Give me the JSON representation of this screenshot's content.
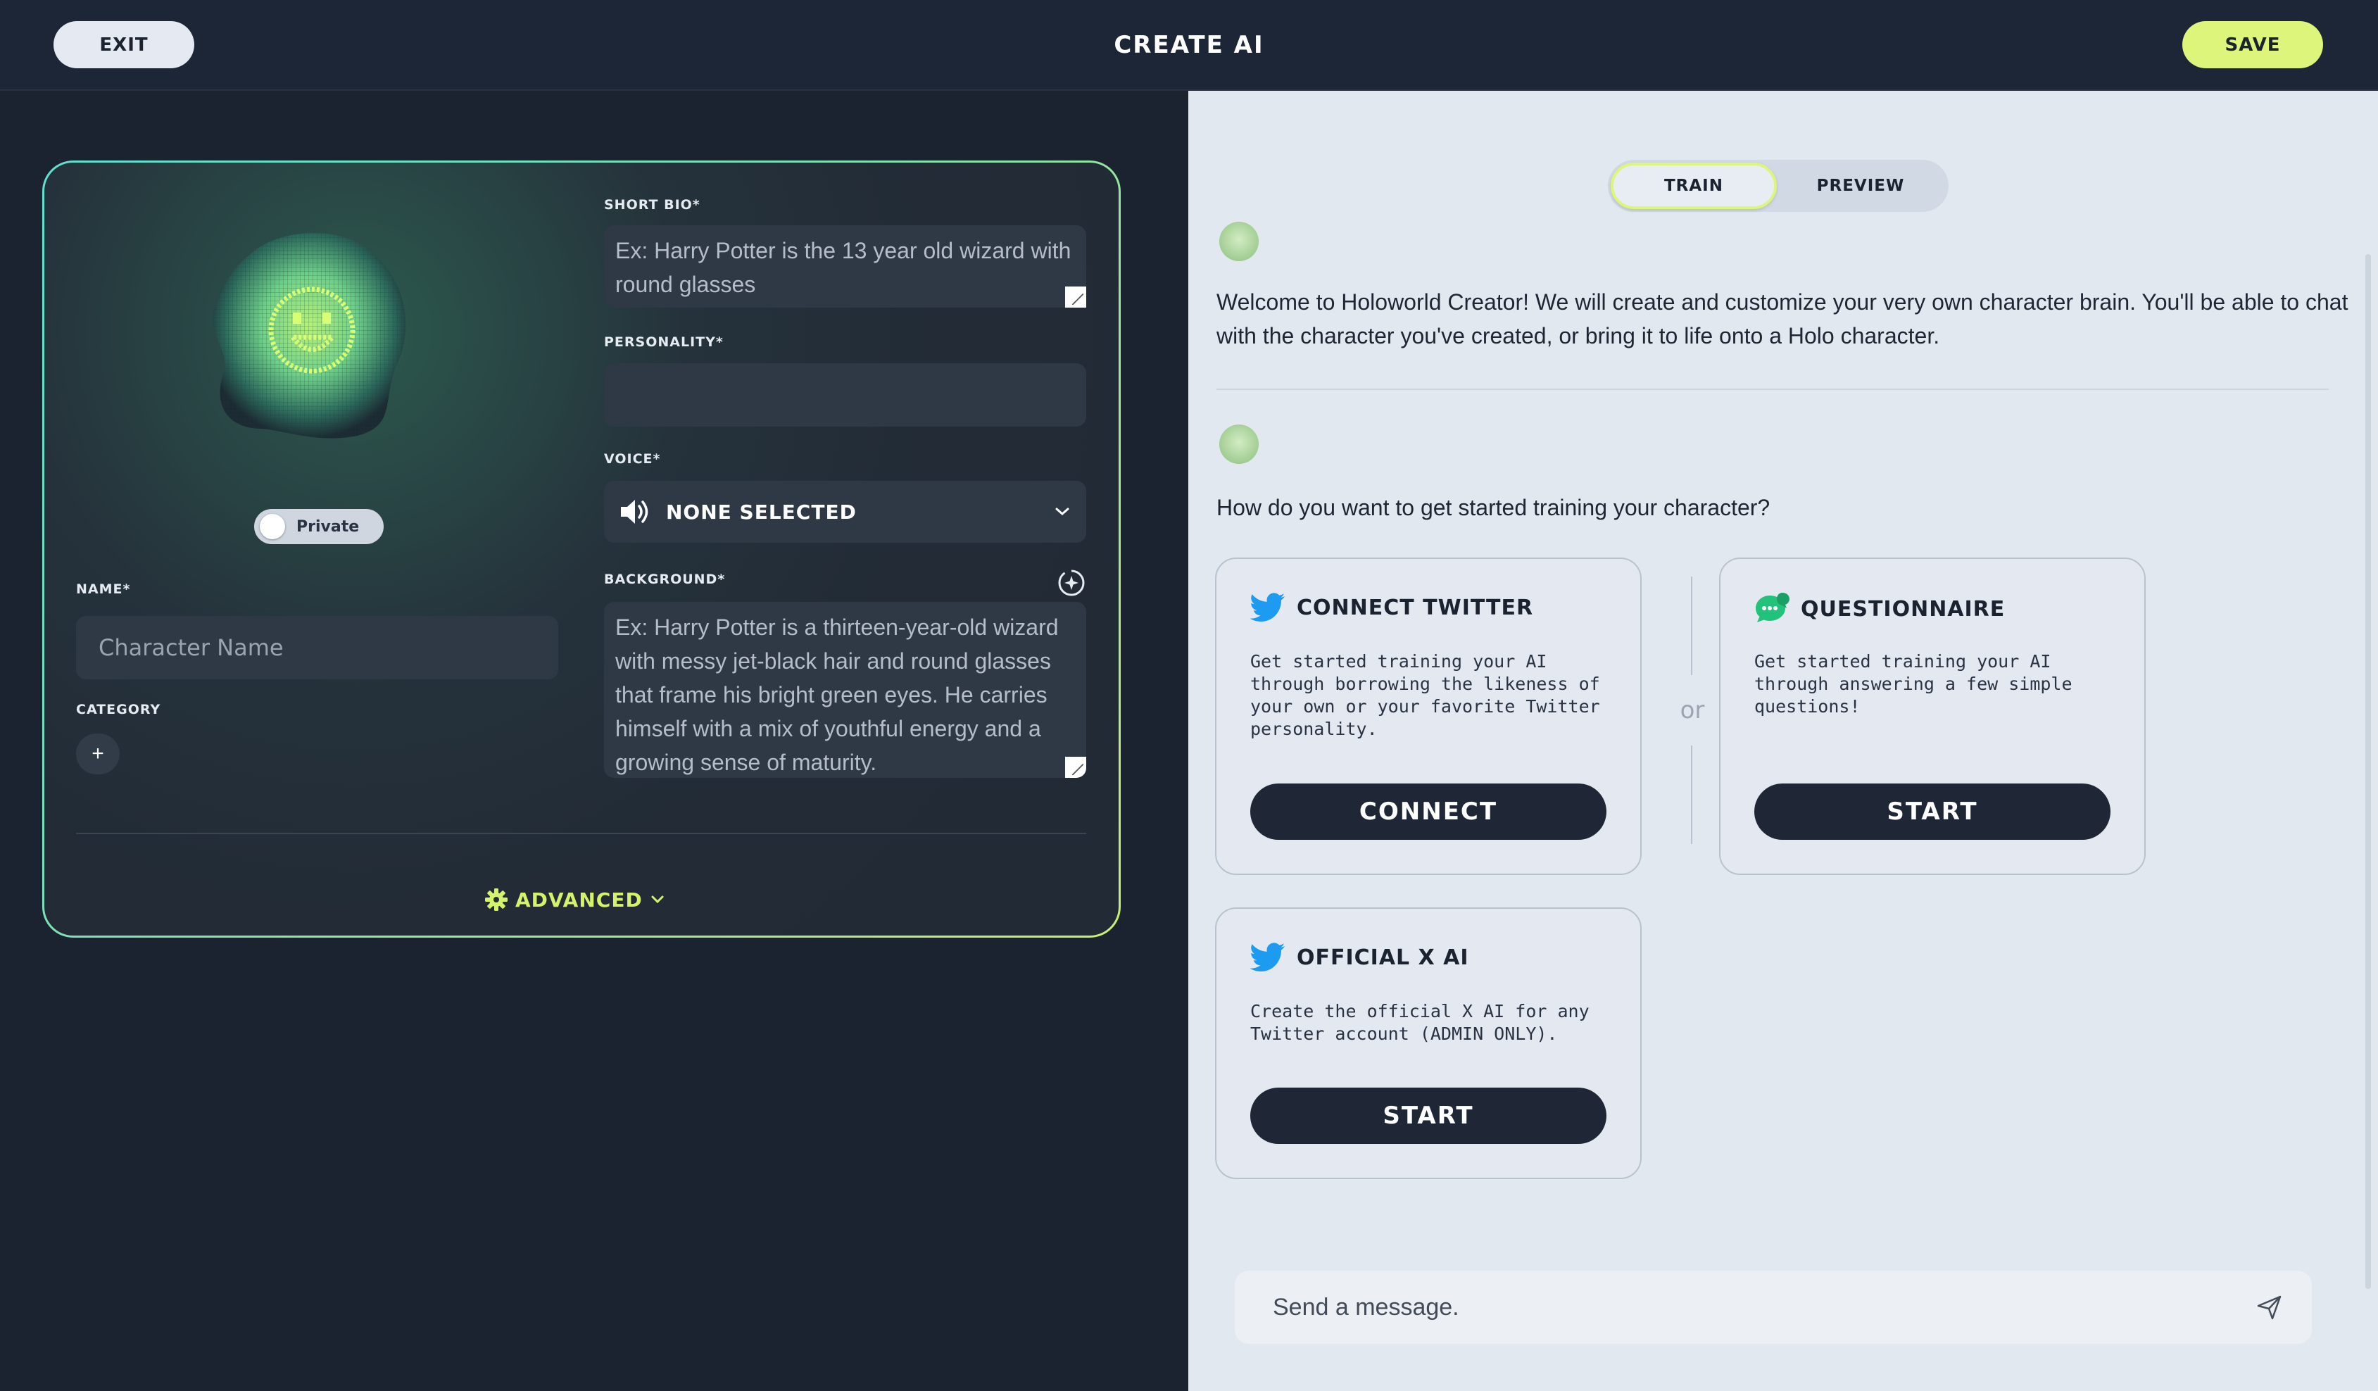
{
  "header": {
    "exit_label": "EXIT",
    "title": "CREATE AI",
    "save_label": "SAVE"
  },
  "character": {
    "private_label": "Private",
    "name_label": "NAME*",
    "name_placeholder": "Character Name",
    "category_label": "CATEGORY",
    "category_add": "+",
    "short_bio_label": "SHORT BIO*",
    "short_bio_placeholder": "Ex: Harry Potter is the 13 year old wizard with round glasses",
    "personality_label": "PERSONALITY*",
    "voice_label": "VOICE*",
    "voice_value": "NONE SELECTED",
    "background_label": "BACKGROUND*",
    "background_placeholder": "Ex: Harry Potter is a thirteen-year-old wizard with messy jet-black hair and round glasses that frame his bright green eyes. He carries himself with a mix of youthful energy and a growing sense of maturity.",
    "advanced_label": "ADVANCED"
  },
  "train_panel": {
    "tabs": [
      {
        "label": "TRAIN",
        "active": true
      },
      {
        "label": "PREVIEW",
        "active": false
      }
    ],
    "welcome_message": "Welcome to Holoworld Creator! We will create and customize your very own character brain. You'll be able to chat with the character you've created, or bring it to life onto a Holo character.",
    "question_message": "How do you want to get started training your character?",
    "or_label": "or",
    "options": [
      {
        "title": "CONNECT TWITTER",
        "description": "Get started training your AI through borrowing the likeness of your own or your favorite Twitter personality.",
        "button": "CONNECT",
        "icon": "twitter-icon"
      },
      {
        "title": "QUESTIONNAIRE",
        "description": "Get started training your AI through answering a few simple questions!",
        "button": "START",
        "icon": "chat-bubble-icon"
      },
      {
        "title": "OFFICIAL X AI",
        "description": "Create the official X AI for any Twitter account (ADMIN ONLY).",
        "button": "START",
        "icon": "twitter-icon"
      }
    ],
    "chat_placeholder": "Send a message."
  },
  "colors": {
    "accent": "#dcf57a",
    "dark_bg": "#1b2230",
    "light_bg": "#e2e8f0",
    "twitter_blue": "#1d9bf0",
    "questionnaire_green": "#23c27a"
  }
}
